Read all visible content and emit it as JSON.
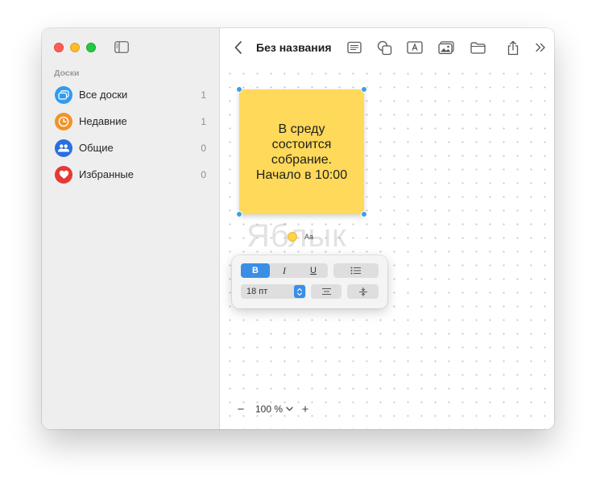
{
  "window": {
    "title": "Без названия"
  },
  "sidebar": {
    "section_label": "Доски",
    "items": [
      {
        "label": "Все доски",
        "count": "1",
        "icon": "boards-icon",
        "color": "#2f9bf2"
      },
      {
        "label": "Недавние",
        "count": "1",
        "icon": "clock-icon",
        "color": "#f0932b"
      },
      {
        "label": "Общие",
        "count": "0",
        "icon": "people-icon",
        "color": "#2a6fe0"
      },
      {
        "label": "Избранные",
        "count": "0",
        "icon": "heart-icon",
        "color": "#e53935"
      }
    ]
  },
  "canvas": {
    "sticky_note_text": "В среду\nсостоится\nсобрание.\nНачало в 10:00",
    "sticky_color": "#ffd95a",
    "watermark": "Яблык",
    "style_label": "Aa"
  },
  "format_popover": {
    "bold": "B",
    "italic": "I",
    "underline": "U",
    "font_size": "18 пт"
  },
  "zoom": {
    "minus": "−",
    "value": "100 %",
    "plus": "+"
  },
  "colors": {
    "accent": "#3a8ee6",
    "handle": "#3d9ee6"
  }
}
